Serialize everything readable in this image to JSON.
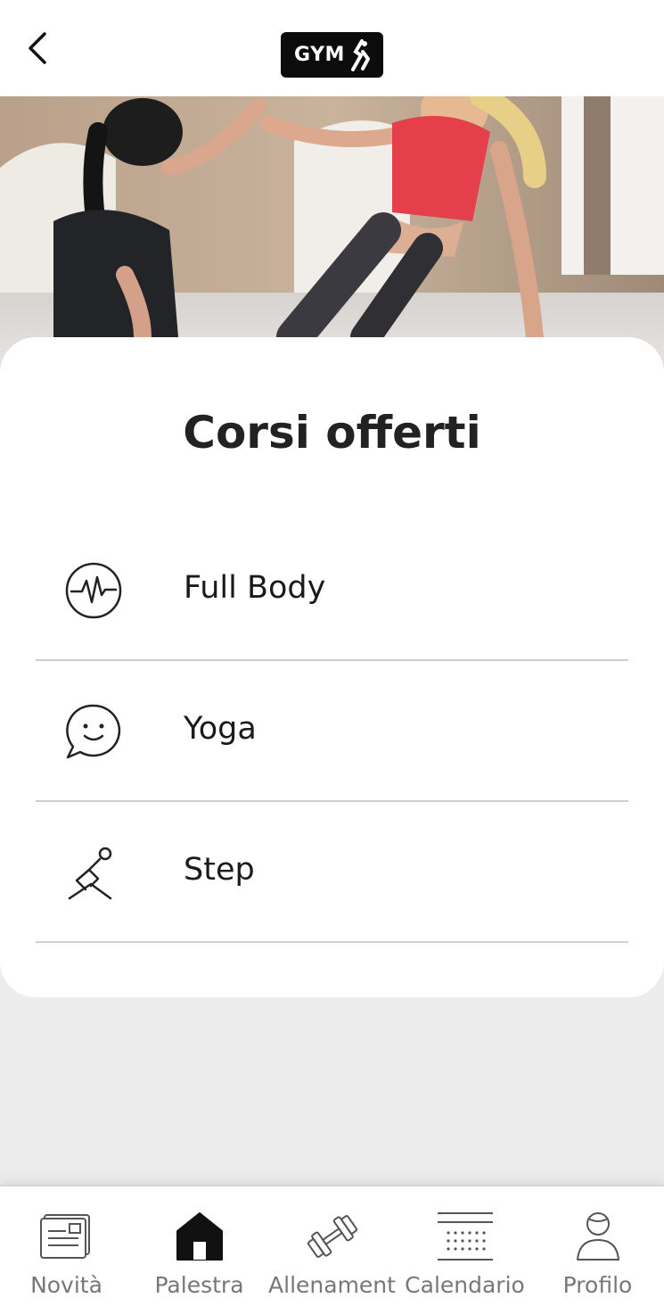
{
  "header": {
    "logo_text": "GYM"
  },
  "main": {
    "title": "Corsi offerti",
    "courses": [
      {
        "label": "Full Body",
        "icon": "heartbeat-icon"
      },
      {
        "label": "Yoga",
        "icon": "smile-chat-icon"
      },
      {
        "label": "Step",
        "icon": "squat-exercise-icon"
      }
    ]
  },
  "bottom_nav": {
    "active": "Palestra",
    "items": [
      {
        "label": "Novità",
        "icon": "newspaper-icon"
      },
      {
        "label": "Palestra",
        "icon": "gym-home-icon"
      },
      {
        "label": "Allenament",
        "icon": "dumbbell-icon"
      },
      {
        "label": "Calendario",
        "icon": "calendar-icon"
      },
      {
        "label": "Profilo",
        "icon": "user-icon"
      }
    ]
  },
  "colors": {
    "accent": "#0c0c0c",
    "background": "#ececec",
    "divider": "#cfcfcf",
    "nav_label": "#777777"
  }
}
